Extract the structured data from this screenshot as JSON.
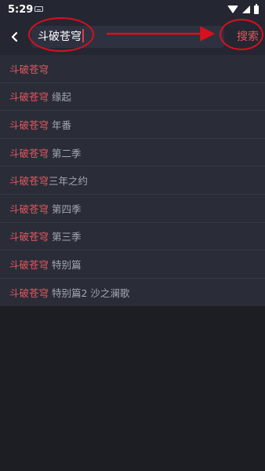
{
  "status_bar": {
    "time": "5:29"
  },
  "search": {
    "query": "斗破苍穹",
    "button_label": "搜索"
  },
  "suggestions": [
    {
      "keyword": "斗破苍穹",
      "suffix": ""
    },
    {
      "keyword": "斗破苍穹",
      "suffix": " 缘起"
    },
    {
      "keyword": "斗破苍穹",
      "suffix": " 年番"
    },
    {
      "keyword": "斗破苍穹",
      "suffix": " 第二季"
    },
    {
      "keyword": "斗破苍穹",
      "suffix": "三年之约"
    },
    {
      "keyword": "斗破苍穹",
      "suffix": " 第四季"
    },
    {
      "keyword": "斗破苍穹",
      "suffix": " 第三季"
    },
    {
      "keyword": "斗破苍穹",
      "suffix": " 特别篇"
    },
    {
      "keyword": "斗破苍穹",
      "suffix": " 特别篇2 沙之澜歌"
    }
  ],
  "colors": {
    "accent": "#e2585f",
    "annotation": "#d8101e",
    "background": "#1c1e24"
  }
}
